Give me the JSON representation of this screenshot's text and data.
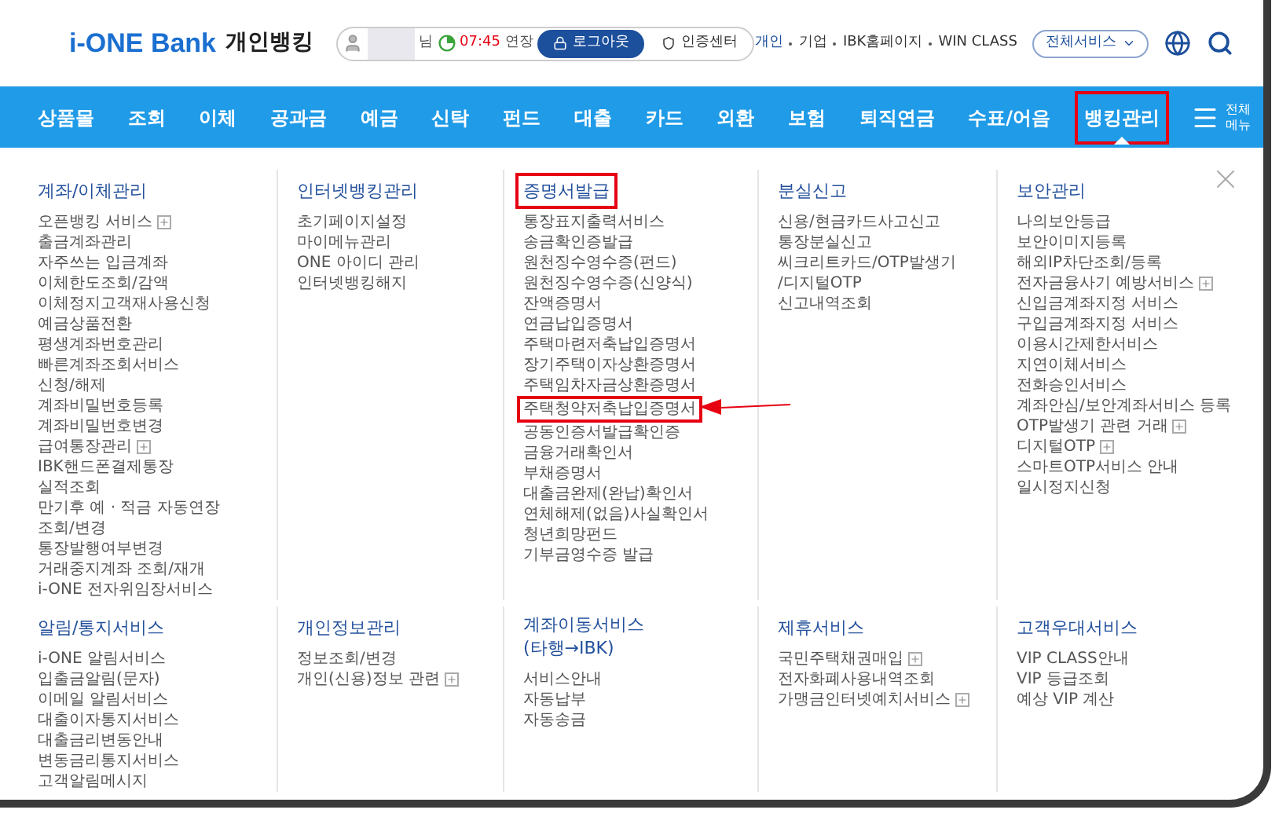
{
  "header": {
    "brand": "i-ONE Bank",
    "title": "개인뱅킹",
    "session": {
      "suffix": "님",
      "time": "07:45",
      "extend": "연장",
      "logout": "로그아웃",
      "cert": "인증센터"
    },
    "links": [
      "개인",
      "기업",
      "IBK홈페이지",
      "WIN CLASS"
    ],
    "service_select": "전체서비스"
  },
  "nav": {
    "items": [
      {
        "label": "상품몰",
        "selected": false,
        "highlighted": false
      },
      {
        "label": "조회",
        "selected": false,
        "highlighted": false
      },
      {
        "label": "이체",
        "selected": false,
        "highlighted": false
      },
      {
        "label": "공과금",
        "selected": false,
        "highlighted": false
      },
      {
        "label": "예금",
        "selected": false,
        "highlighted": false
      },
      {
        "label": "신탁",
        "selected": false,
        "highlighted": false
      },
      {
        "label": "펀드",
        "selected": false,
        "highlighted": false
      },
      {
        "label": "대출",
        "selected": false,
        "highlighted": false
      },
      {
        "label": "카드",
        "selected": false,
        "highlighted": false
      },
      {
        "label": "외환",
        "selected": false,
        "highlighted": false
      },
      {
        "label": "보험",
        "selected": false,
        "highlighted": false
      },
      {
        "label": "퇴직연금",
        "selected": false,
        "highlighted": false
      },
      {
        "label": "수표/어음",
        "selected": false,
        "highlighted": false
      },
      {
        "label": "뱅킹관리",
        "selected": true,
        "highlighted": true
      }
    ],
    "all_menu": "전체\n메뉴"
  },
  "menu": {
    "sections": [
      {
        "columns": [
          {
            "title": "계좌/이체관리",
            "highlighted": false,
            "items": [
              {
                "label": "오픈뱅킹 서비스",
                "plus": true,
                "highlighted": false
              },
              {
                "label": "출금계좌관리",
                "plus": false,
                "highlighted": false
              },
              {
                "label": "자주쓰는 입금계좌",
                "plus": false,
                "highlighted": false
              },
              {
                "label": "이체한도조회/감액",
                "plus": false,
                "highlighted": false
              },
              {
                "label": "이체정지고객재사용신청",
                "plus": false,
                "highlighted": false
              },
              {
                "label": "예금상품전환",
                "plus": false,
                "highlighted": false
              },
              {
                "label": "평생계좌번호관리",
                "plus": false,
                "highlighted": false
              },
              {
                "label": "빠른계좌조회서비스\n신청/해제",
                "plus": false,
                "highlighted": false
              },
              {
                "label": "계좌비밀번호등록",
                "plus": false,
                "highlighted": false
              },
              {
                "label": "계좌비밀번호변경",
                "plus": false,
                "highlighted": false
              },
              {
                "label": "급여통장관리",
                "plus": true,
                "highlighted": false
              },
              {
                "label": "IBK핸드폰결제통장\n실적조회",
                "plus": false,
                "highlighted": false
              },
              {
                "label": "만기후 예 · 적금 자동연장\n조회/변경",
                "plus": false,
                "highlighted": false
              },
              {
                "label": "통장발행여부변경",
                "plus": false,
                "highlighted": false
              },
              {
                "label": "거래중지계좌 조회/재개",
                "plus": false,
                "highlighted": false
              },
              {
                "label": "i-ONE 전자위임장서비스",
                "plus": false,
                "highlighted": false
              }
            ]
          },
          {
            "title": "인터넷뱅킹관리",
            "highlighted": false,
            "items": [
              {
                "label": "초기페이지설정",
                "plus": false,
                "highlighted": false
              },
              {
                "label": "마이메뉴관리",
                "plus": false,
                "highlighted": false
              },
              {
                "label": "ONE 아이디 관리",
                "plus": false,
                "highlighted": false
              },
              {
                "label": "인터넷뱅킹해지",
                "plus": false,
                "highlighted": false
              }
            ]
          },
          {
            "title": "증명서발급",
            "highlighted": true,
            "items": [
              {
                "label": "통장표지출력서비스",
                "plus": false,
                "highlighted": false
              },
              {
                "label": "송금확인증발급",
                "plus": false,
                "highlighted": false
              },
              {
                "label": "원천징수영수증(펀드)",
                "plus": false,
                "highlighted": false
              },
              {
                "label": "원천징수영수증(신양식)",
                "plus": false,
                "highlighted": false
              },
              {
                "label": "잔액증명서",
                "plus": false,
                "highlighted": false
              },
              {
                "label": "연금납입증명서",
                "plus": false,
                "highlighted": false
              },
              {
                "label": "주택마련저축납입증명서",
                "plus": false,
                "highlighted": false
              },
              {
                "label": "장기주택이자상환증명서",
                "plus": false,
                "highlighted": false
              },
              {
                "label": "주택임차자금상환증명서",
                "plus": false,
                "highlighted": false
              },
              {
                "label": "주택청약저축납입증명서",
                "plus": false,
                "highlighted": true
              },
              {
                "label": "공동인증서발급확인증",
                "plus": false,
                "highlighted": false
              },
              {
                "label": "금융거래확인서",
                "plus": false,
                "highlighted": false
              },
              {
                "label": "부채증명서",
                "plus": false,
                "highlighted": false
              },
              {
                "label": "대출금완제(완납)확인서",
                "plus": false,
                "highlighted": false
              },
              {
                "label": "연체해제(없음)사실확인서",
                "plus": false,
                "highlighted": false
              },
              {
                "label": "청년희망펀드\n기부금영수증 발급",
                "plus": false,
                "highlighted": false
              }
            ]
          },
          {
            "title": "분실신고",
            "highlighted": false,
            "items": [
              {
                "label": "신용/현금카드사고신고",
                "plus": false,
                "highlighted": false
              },
              {
                "label": "통장분실신고",
                "plus": false,
                "highlighted": false
              },
              {
                "label": "씨크리트카드/OTP발생기\n/디지털OTP",
                "plus": false,
                "highlighted": false
              },
              {
                "label": "신고내역조회",
                "plus": false,
                "highlighted": false
              }
            ]
          },
          {
            "title": "보안관리",
            "highlighted": false,
            "items": [
              {
                "label": "나의보안등급",
                "plus": false,
                "highlighted": false
              },
              {
                "label": "보안이미지등록",
                "plus": false,
                "highlighted": false
              },
              {
                "label": "해외IP차단조회/등록",
                "plus": false,
                "highlighted": false
              },
              {
                "label": "전자금융사기 예방서비스",
                "plus": true,
                "highlighted": false
              },
              {
                "label": "신입금계좌지정 서비스",
                "plus": false,
                "highlighted": false
              },
              {
                "label": "구입금계좌지정 서비스",
                "plus": false,
                "highlighted": false
              },
              {
                "label": "이용시간제한서비스",
                "plus": false,
                "highlighted": false
              },
              {
                "label": "지연이체서비스",
                "plus": false,
                "highlighted": false
              },
              {
                "label": "전화승인서비스",
                "plus": false,
                "highlighted": false
              },
              {
                "label": "계좌안심/보안계좌서비스 등록",
                "plus": false,
                "highlighted": false
              },
              {
                "label": "OTP발생기 관련 거래",
                "plus": true,
                "highlighted": false
              },
              {
                "label": "디지털OTP",
                "plus": true,
                "highlighted": false
              },
              {
                "label": "스마트OTP서비스 안내",
                "plus": false,
                "highlighted": false
              },
              {
                "label": "일시정지신청",
                "plus": false,
                "highlighted": false
              }
            ]
          }
        ]
      },
      {
        "columns": [
          {
            "title": "알림/통지서비스",
            "highlighted": false,
            "items": [
              {
                "label": "i-ONE 알림서비스",
                "plus": false,
                "highlighted": false
              },
              {
                "label": "입출금알림(문자)",
                "plus": false,
                "highlighted": false
              },
              {
                "label": "이메일 알림서비스",
                "plus": false,
                "highlighted": false
              },
              {
                "label": "대출이자통지서비스",
                "plus": false,
                "highlighted": false
              },
              {
                "label": "대출금리변동안내",
                "plus": false,
                "highlighted": false
              },
              {
                "label": "변동금리통지서비스",
                "plus": false,
                "highlighted": false
              },
              {
                "label": "고객알림메시지",
                "plus": false,
                "highlighted": false
              }
            ]
          },
          {
            "title": "개인정보관리",
            "highlighted": false,
            "items": [
              {
                "label": "정보조회/변경",
                "plus": false,
                "highlighted": false
              },
              {
                "label": "개인(신용)정보 관련",
                "plus": true,
                "highlighted": false
              }
            ]
          },
          {
            "title": "계좌이동서비스\n(타행→IBK)",
            "highlighted": false,
            "items": [
              {
                "label": "서비스안내",
                "plus": false,
                "highlighted": false
              },
              {
                "label": "자동납부",
                "plus": false,
                "highlighted": false
              },
              {
                "label": "자동송금",
                "plus": false,
                "highlighted": false
              }
            ]
          },
          {
            "title": "제휴서비스",
            "highlighted": false,
            "items": [
              {
                "label": "국민주택채권매입",
                "plus": true,
                "highlighted": false
              },
              {
                "label": "전자화폐사용내역조회",
                "plus": false,
                "highlighted": false
              },
              {
                "label": "가맹금인터넷예치서비스",
                "plus": true,
                "highlighted": false
              }
            ]
          },
          {
            "title": "고객우대서비스",
            "highlighted": false,
            "items": [
              {
                "label": "VIP CLASS안내",
                "plus": false,
                "highlighted": false
              },
              {
                "label": "VIP 등급조회",
                "plus": false,
                "highlighted": false
              },
              {
                "label": "예상 VIP 계산",
                "plus": false,
                "highlighted": false
              }
            ]
          }
        ]
      }
    ]
  }
}
